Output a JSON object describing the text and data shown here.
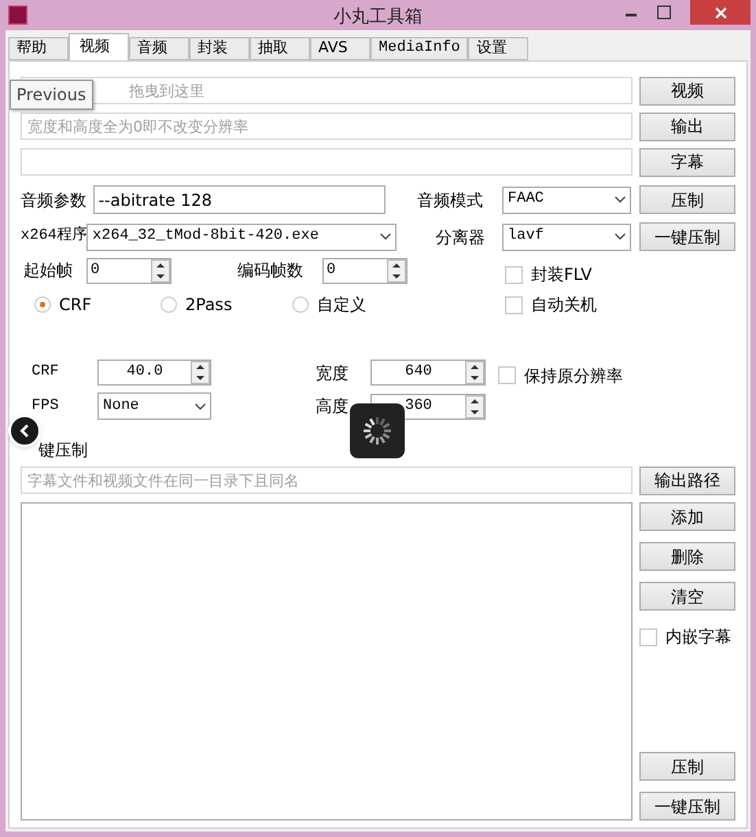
{
  "window": {
    "title": "小丸工具箱"
  },
  "tabs": [
    {
      "label": "帮助",
      "selected": false
    },
    {
      "label": "视频",
      "selected": true
    },
    {
      "label": "音频",
      "selected": false
    },
    {
      "label": "封装",
      "selected": false
    },
    {
      "label": "抽取",
      "selected": false
    },
    {
      "label": "AVS",
      "selected": false
    },
    {
      "label": "MediaInfo",
      "selected": false
    },
    {
      "label": "设置",
      "selected": false
    }
  ],
  "tooltip": "Previous",
  "top_fields": [
    {
      "placeholder": "拖曳到这里",
      "button": "视频"
    },
    {
      "placeholder": "宽度和高度全为0即不改变分辨率",
      "button": "输出"
    },
    {
      "button": "字幕"
    }
  ],
  "audio_params": {
    "label": "音频参数",
    "value": "--abitrate 128"
  },
  "audio_mode": {
    "label": "音频模式",
    "value": "FAAC"
  },
  "x264": {
    "label": "x264程序",
    "value": "x264_32_tMod-8bit-420.exe"
  },
  "splitter": {
    "label": "分离器",
    "value": "lavf"
  },
  "start_frame": {
    "label": "起始帧",
    "value": "0"
  },
  "frame_count": {
    "label": "编码帧数",
    "value": "0"
  },
  "side_buttons": [
    "压制",
    "一键压制"
  ],
  "side_checks": [
    {
      "label": "封装FLV",
      "checked": false
    },
    {
      "label": "自动关机",
      "checked": false
    }
  ],
  "modes": [
    {
      "label": "CRF",
      "selected": true
    },
    {
      "label": "2Pass",
      "selected": false
    },
    {
      "label": "自定义",
      "selected": false
    }
  ],
  "crf": {
    "label": "CRF",
    "value": "40.0"
  },
  "fps": {
    "label": "FPS",
    "value": "None"
  },
  "width": {
    "label": "宽度",
    "value": "640"
  },
  "height": {
    "label": "高度",
    "value": "360"
  },
  "keep_resolution": {
    "label": "保持原分辨率",
    "checked": false
  },
  "batch": {
    "title": "键压制",
    "placeholder": "字幕文件和视频文件在同一目录下且同名",
    "path_button": "输出路径",
    "buttons": [
      "添加",
      "删除",
      "清空"
    ],
    "embed": {
      "label": "内嵌字幕",
      "checked": false
    },
    "bottom_buttons": [
      "压制",
      "一键压制"
    ]
  }
}
